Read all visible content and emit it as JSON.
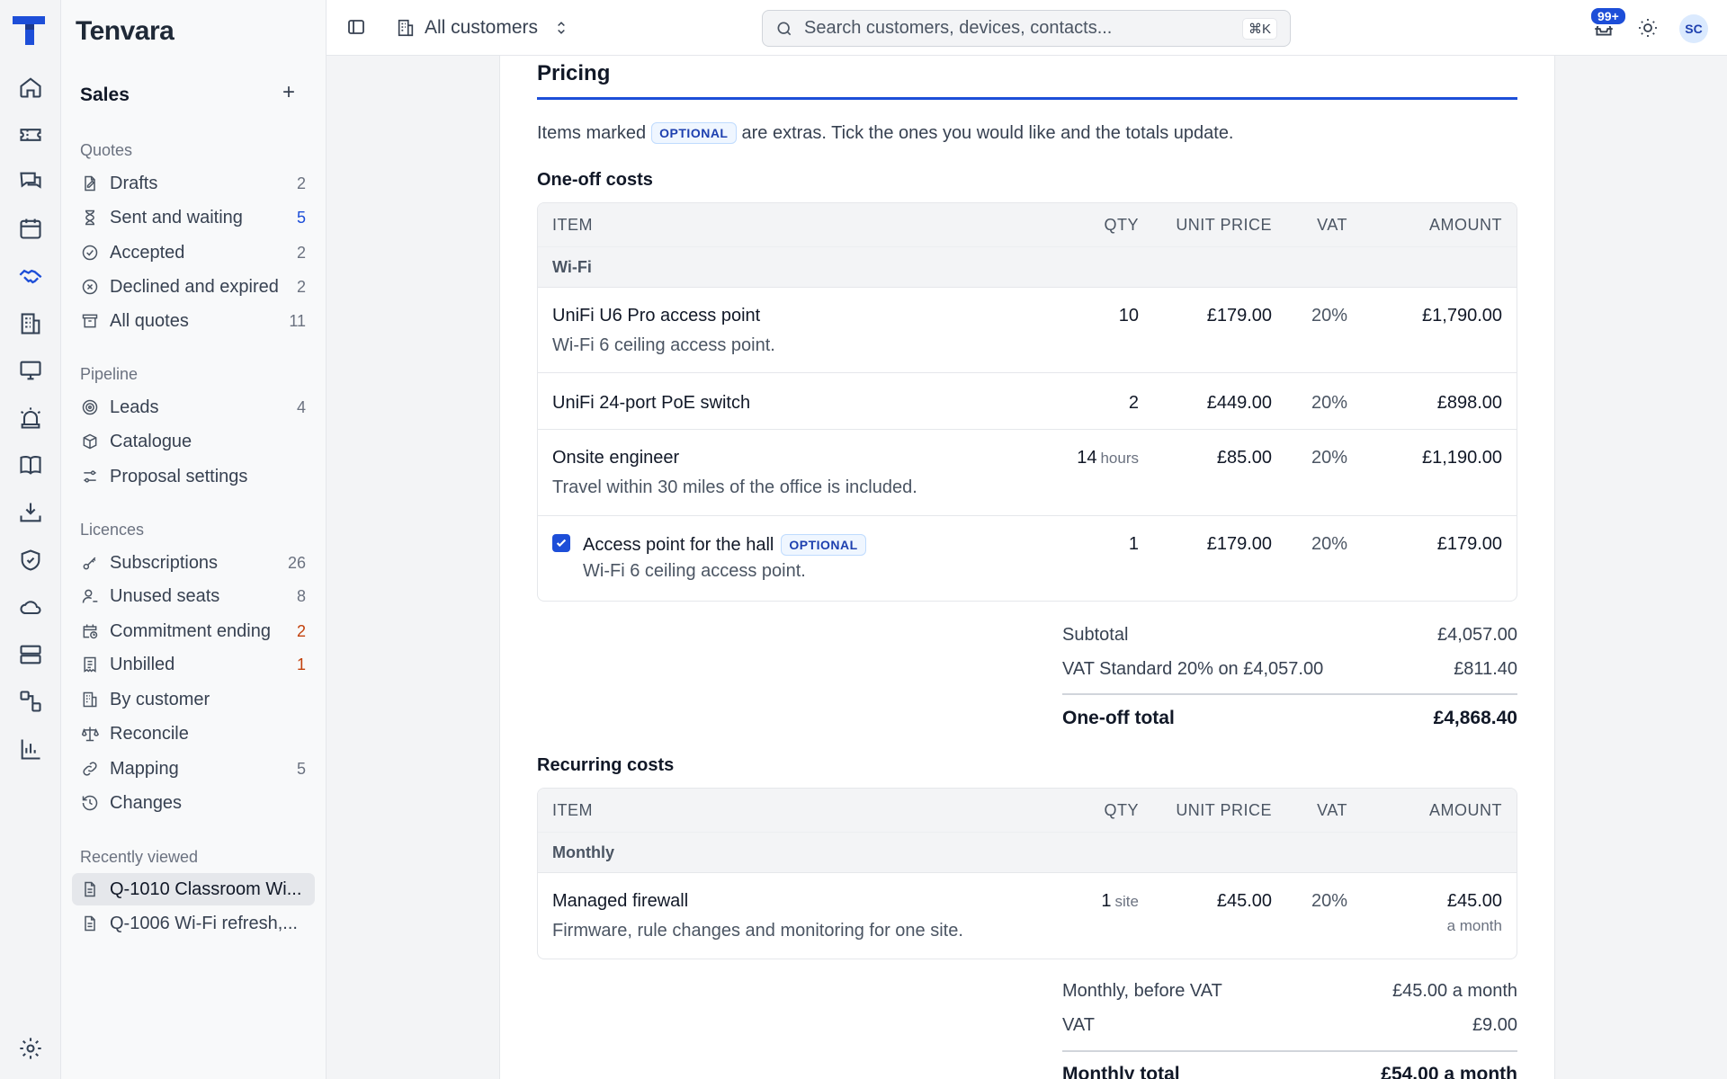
{
  "app": {
    "brand": "Tenvara"
  },
  "topbar": {
    "customer_selector": "All customers",
    "search_placeholder": "Search customers, devices, contacts...",
    "search_shortcut": "⌘K",
    "notifications_badge": "99+",
    "user_initials": "SC"
  },
  "sidebar": {
    "section_title": "Sales",
    "groups": {
      "quotes": "Quotes",
      "pipeline": "Pipeline",
      "licences": "Licences",
      "recent": "Recently viewed"
    },
    "quotes": [
      {
        "label": "Drafts",
        "count": "2"
      },
      {
        "label": "Sent and waiting",
        "count": "5"
      },
      {
        "label": "Accepted",
        "count": "2"
      },
      {
        "label": "Declined and expired",
        "count": "2"
      },
      {
        "label": "All quotes",
        "count": "11"
      }
    ],
    "pipeline": [
      {
        "label": "Leads",
        "count": "4"
      },
      {
        "label": "Catalogue",
        "count": ""
      },
      {
        "label": "Proposal settings",
        "count": ""
      }
    ],
    "licences": [
      {
        "label": "Subscriptions",
        "count": "26"
      },
      {
        "label": "Unused seats",
        "count": "8"
      },
      {
        "label": "Commitment ending",
        "count": "2"
      },
      {
        "label": "Unbilled",
        "count": "1"
      },
      {
        "label": "By customer",
        "count": ""
      },
      {
        "label": "Reconcile",
        "count": ""
      },
      {
        "label": "Mapping",
        "count": "5"
      },
      {
        "label": "Changes",
        "count": ""
      }
    ],
    "recent": [
      {
        "label": "Q-1010 Classroom Wi..."
      },
      {
        "label": "Q-1006 Wi-Fi refresh,..."
      }
    ]
  },
  "pricing": {
    "title": "Pricing",
    "intro_before": "Items marked",
    "optional_tag": "OPTIONAL",
    "intro_after": "are extras. Tick the ones you would like and the totals update.",
    "columns": {
      "item": "ITEM",
      "qty": "QTY",
      "unit_price": "UNIT PRICE",
      "vat": "VAT",
      "amount": "AMOUNT"
    },
    "oneoff": {
      "title": "One-off costs",
      "group": "Wi-Fi",
      "rows": [
        {
          "name": "UniFi U6 Pro access point",
          "desc": "Wi-Fi 6 ceiling access point.",
          "qty": "10",
          "unit": "",
          "unit_price": "£179.00",
          "vat": "20%",
          "amount": "£1,790.00"
        },
        {
          "name": "UniFi 24-port PoE switch",
          "desc": "",
          "qty": "2",
          "unit": "",
          "unit_price": "£449.00",
          "vat": "20%",
          "amount": "£898.00"
        },
        {
          "name": "Onsite engineer",
          "desc": "Travel within 30 miles of the office is included.",
          "qty": "14",
          "unit": "hours",
          "unit_price": "£85.00",
          "vat": "20%",
          "amount": "£1,190.00"
        },
        {
          "name": "Access point for the hall",
          "desc": "Wi-Fi 6 ceiling access point.",
          "qty": "1",
          "unit": "",
          "unit_price": "£179.00",
          "vat": "20%",
          "amount": "£179.00",
          "optional": true,
          "checked": true
        }
      ],
      "subtotal_label": "Subtotal",
      "subtotal": "£4,057.00",
      "vat_label": "VAT Standard 20% on £4,057.00",
      "vat": "£811.40",
      "total_label": "One-off total",
      "total": "£4,868.40"
    },
    "recurring": {
      "title": "Recurring costs",
      "group": "Monthly",
      "rows": [
        {
          "name": "Managed firewall",
          "desc": "Firmware, rule changes and monitoring for one site.",
          "qty": "1",
          "unit": "site",
          "unit_price": "£45.00",
          "vat": "20%",
          "amount": "£45.00",
          "amount_sub": "a month"
        }
      ],
      "before_vat_label": "Monthly, before VAT",
      "before_vat": "£45.00 a month",
      "vat_label": "VAT",
      "vat": "£9.00",
      "total_label": "Monthly total",
      "total": "£54.00 a month"
    }
  }
}
